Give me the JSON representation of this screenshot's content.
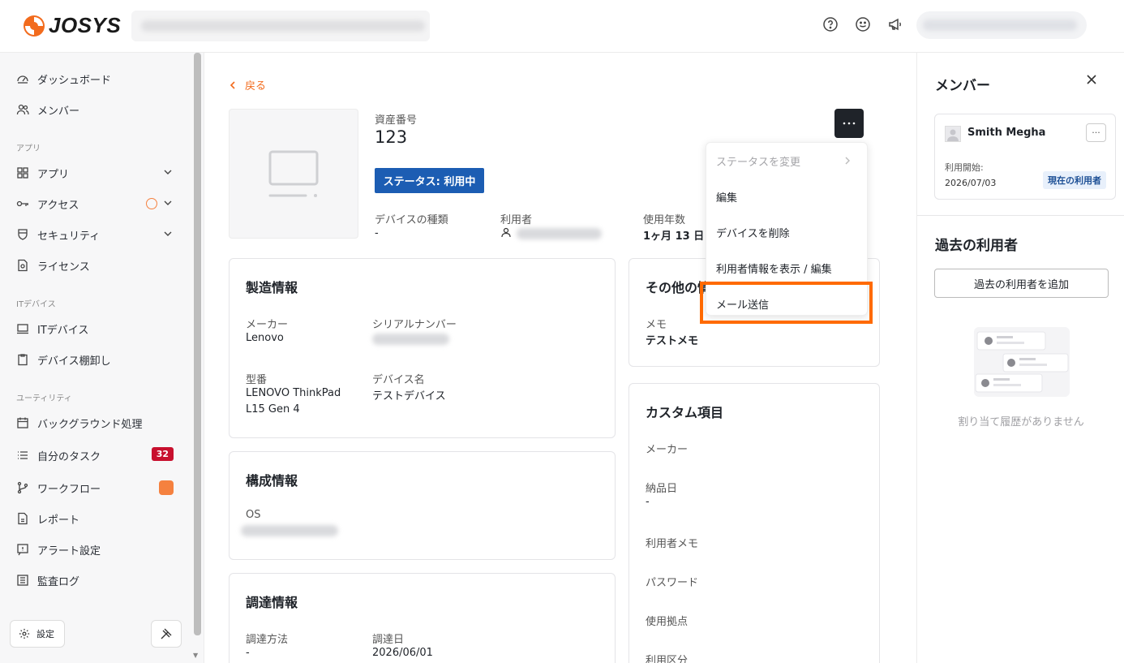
{
  "header": {
    "logo_text": "JOSYS",
    "accent": "#f26b1d"
  },
  "sidebar": {
    "items": [
      {
        "label": "ダッシュボード",
        "icon": "gauge-icon"
      },
      {
        "label": "メンバー",
        "icon": "users-icon"
      },
      {
        "label": "アプリ",
        "icon": "grid-icon"
      },
      {
        "label": "アクセス",
        "icon": "key-icon"
      },
      {
        "label": "セキュリティ",
        "icon": "shield-icon"
      },
      {
        "label": "ライセンス",
        "icon": "license-icon"
      },
      {
        "label": "ITデバイス",
        "icon": "laptop-icon"
      },
      {
        "label": "デバイス棚卸し",
        "icon": "clipboard-icon"
      },
      {
        "label": "バックグラウンド処理",
        "icon": "calendar-icon"
      },
      {
        "label": "自分のタスク",
        "icon": "list-icon"
      },
      {
        "label": "ワークフロー",
        "icon": "branch-icon"
      },
      {
        "label": "レポート",
        "icon": "report-icon"
      },
      {
        "label": "アラート設定",
        "icon": "alert-icon"
      },
      {
        "label": "監査ログ",
        "icon": "log-icon"
      }
    ],
    "sections": {
      "apps": "アプリ",
      "it_devices": "ITデバイス",
      "utility": "ユーティリティ"
    },
    "task_count": "32",
    "settings_label": "設定"
  },
  "main": {
    "back_label": "戻る",
    "asset_number_label": "資産番号",
    "asset_number": "123",
    "status_button": "ステータス: 利用中",
    "device_type_label": "デバイスの種類",
    "device_type": "-",
    "user_label": "利用者",
    "years_label": "使用年数",
    "years": "1ヶ月 13 日",
    "manufacturing": {
      "title": "製造情報",
      "maker_label": "メーカー",
      "maker": "Lenovo",
      "serial_label": "シリアルナンバー",
      "model_label": "型番",
      "model_line1": "LENOVO ThinkPad",
      "model_line2": "L15 Gen 4",
      "device_name_label": "デバイス名",
      "device_name": "テストデバイス"
    },
    "configuration": {
      "title": "構成情報",
      "os_label": "OS"
    },
    "procurement": {
      "title": "調達情報",
      "method_label": "調達方法",
      "method": "-",
      "date_label": "調達日",
      "date": "2026/06/01"
    },
    "other": {
      "title": "その他の情",
      "memo_label": "メモ",
      "memo": "テストメモ"
    },
    "custom": {
      "title": "カスタム項目",
      "fields": [
        "メーカー",
        "納品日",
        "利用者メモ",
        "パスワード",
        "使用拠点",
        "利用区分"
      ],
      "delivery_value": "-"
    }
  },
  "menu": {
    "items": [
      "ステータスを変更",
      "編集",
      "デバイスを削除",
      "利用者情報を表示 / 編集",
      "メール送信"
    ]
  },
  "right_panel": {
    "title": "メンバー",
    "member_name": "Smith Megha",
    "start_label": "利用開始:",
    "start_date": "2026/07/03",
    "current_badge": "現在の利用者",
    "past_title": "過去の利用者",
    "add_past_button": "過去の利用者を追加",
    "empty_text": "割り当て履歴がありません"
  }
}
